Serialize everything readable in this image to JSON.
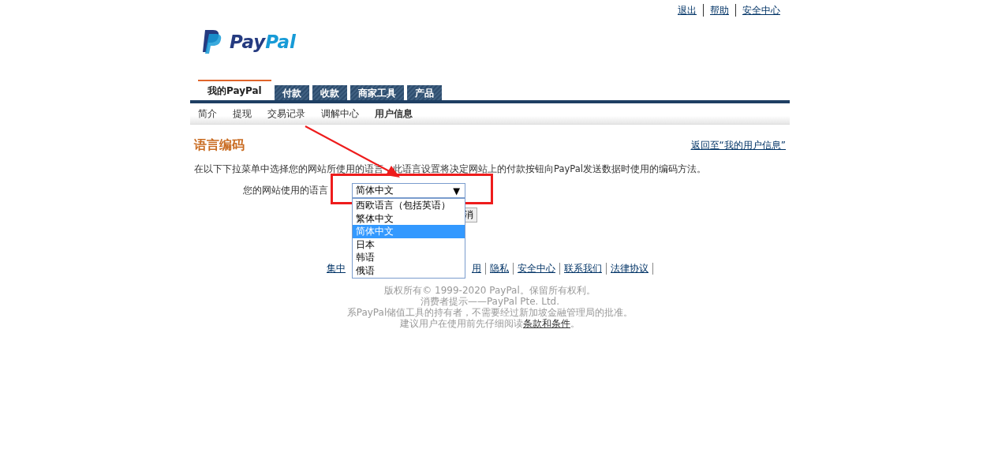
{
  "top_links": [
    "退出",
    "帮助",
    "安全中心"
  ],
  "logo": {
    "parts": [
      "Pay",
      "Pal"
    ]
  },
  "tabs": [
    {
      "label": "我的PayPal",
      "selected": true
    },
    {
      "label": "付款",
      "selected": false
    },
    {
      "label": "收款",
      "selected": false
    },
    {
      "label": "商家工具",
      "selected": false
    },
    {
      "label": "产品",
      "selected": false
    }
  ],
  "subnav": [
    {
      "label": "简介",
      "selected": false
    },
    {
      "label": "提现",
      "selected": false
    },
    {
      "label": "交易记录",
      "selected": false
    },
    {
      "label": "调解中心",
      "selected": false
    },
    {
      "label": "用户信息",
      "selected": true
    }
  ],
  "page_title": "语言编码",
  "back_link": "返回至“我的用户信息”",
  "description": "在以下下拉菜单中选择您的网站所使用的语言，此语言设置将决定网站上的付款按钮向PayPal发送数据时使用的编码方法。",
  "language_field": {
    "label": "您的网站使用的语言",
    "value": "简体中文",
    "caret": "▼",
    "options": [
      {
        "label": "西欧语言（包括英语）",
        "selected": false
      },
      {
        "label": "繁体中文",
        "selected": false
      },
      {
        "label": "简体中文",
        "selected": true
      },
      {
        "label": "日本",
        "selected": false
      },
      {
        "label": "韩语",
        "selected": false
      },
      {
        "label": "俄语",
        "selected": false
      }
    ]
  },
  "buttons": [
    "消"
  ],
  "footer_links": [
    "集中",
    "用",
    "隐私",
    "安全中心",
    "联系我们",
    "法律协议"
  ],
  "footer_lines": [
    "版权所有© 1999-2020 PayPal。保留所有权利。",
    "消费者提示——PayPal Pte. Ltd.",
    "系PayPal储值工具的持有者，不需要经过新加坡金融管理局的批准。"
  ],
  "footer_terms": {
    "text": "建议用户在使用前先仔细阅读",
    "link": "条款和条件",
    "end": "。"
  }
}
